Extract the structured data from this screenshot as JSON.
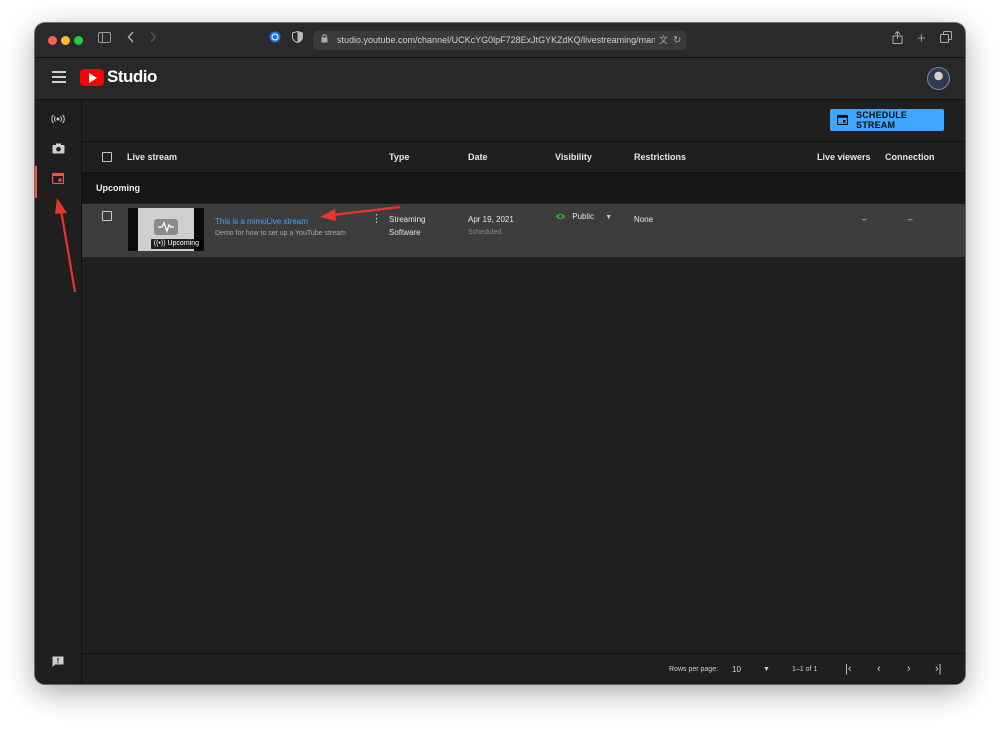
{
  "browser": {
    "url": "studio.youtube.com/channel/UCKcYG0lpF728ExJtGYKZdKQ/livestreaming/manag"
  },
  "header": {
    "logo_text": "Studio"
  },
  "actions": {
    "schedule_label": "SCHEDULE STREAM"
  },
  "table": {
    "columns": {
      "live_stream": "Live stream",
      "type": "Type",
      "date": "Date",
      "visibility": "Visibility",
      "restrictions": "Restrictions",
      "live_viewers": "Live viewers",
      "connection": "Connection"
    },
    "section_label": "Upcoming",
    "rows": [
      {
        "badge": "Upcoming",
        "title": "This is a mimoLive stream",
        "description": "Demo for how to set up a YouTube stream",
        "type_line1": "Streaming",
        "type_line2": "Software",
        "date": "Apr 19, 2021",
        "status": "Scheduled",
        "visibility": "Public",
        "restrictions": "None",
        "live_viewers": "–",
        "connection": "–"
      }
    ]
  },
  "pagination": {
    "rows_per_page_label": "Rows per page:",
    "rows_per_page_value": "10",
    "range": "1–1 of 1"
  },
  "colors": {
    "accent": "#3ea6ff",
    "brand": "#ff0000",
    "active_nav": "#ff4e45",
    "annotation_arrow": "#e8352b",
    "visibility_icon": "#2ba640"
  }
}
